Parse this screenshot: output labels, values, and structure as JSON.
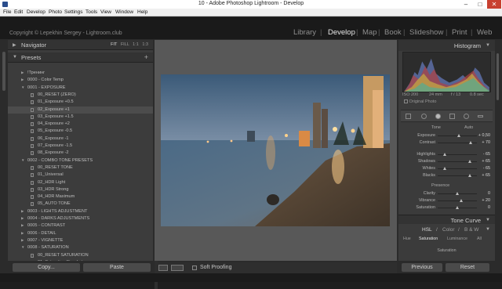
{
  "window": {
    "title": "10 - Adobe Photoshop Lightroom - Develop",
    "controls": [
      "–",
      "□",
      "✕"
    ]
  },
  "menu": [
    "File",
    "Edit",
    "Develop",
    "Photo",
    "Settings",
    "Tools",
    "View",
    "Window",
    "Help"
  ],
  "identity_plate": "Copyright © Lepekhin Sergey - Lightroom.club",
  "modules": {
    "items": [
      "Library",
      "Develop",
      "Map",
      "Book",
      "Slideshow",
      "Print",
      "Web"
    ],
    "active": "Develop",
    "separator": "|"
  },
  "navigator": {
    "label": "Navigator",
    "zoom_options": [
      "FIT",
      "FILL",
      "1:1",
      "1:3"
    ],
    "selected_zoom": "FIT"
  },
  "presets": {
    "label": "Presets",
    "add_symbol": "+",
    "items": [
      {
        "label": "!Тренинг",
        "level": 0,
        "expanded": false
      },
      {
        "label": "0000 - Color Temp",
        "level": 0,
        "expanded": false
      },
      {
        "label": "0001 - EXPOSURE",
        "level": 0,
        "expanded": true
      },
      {
        "label": "00_RESET (ZERO)",
        "level": 1
      },
      {
        "label": "01_Exposure +0.5",
        "level": 1
      },
      {
        "label": "02_Exposure +1",
        "level": 1,
        "highlighted": true
      },
      {
        "label": "03_Exposure +1.5",
        "level": 1
      },
      {
        "label": "04_Exposure +2",
        "level": 1
      },
      {
        "label": "05_Exposure -0.5",
        "level": 1
      },
      {
        "label": "06_Exposure -1",
        "level": 1
      },
      {
        "label": "07_Exposure -1.5",
        "level": 1
      },
      {
        "label": "08_Exposure -2",
        "level": 1
      },
      {
        "label": "0002 - COMBO TONE PRESETS",
        "level": 0,
        "expanded": true
      },
      {
        "label": "00_RESET TONE",
        "level": 1
      },
      {
        "label": "01_Universal",
        "level": 1
      },
      {
        "label": "02_HDR Light",
        "level": 1
      },
      {
        "label": "03_HDR Strong",
        "level": 1
      },
      {
        "label": "04_HDR Maximum",
        "level": 1
      },
      {
        "label": "05_AUTO TONE",
        "level": 1
      },
      {
        "label": "0003 - LIGHTS ADJUSTMENT",
        "level": 0,
        "expanded": false
      },
      {
        "label": "0004 - DARKS ADJUSTMENTS",
        "level": 0,
        "expanded": false
      },
      {
        "label": "0005 - CONTRAST",
        "level": 0,
        "expanded": false
      },
      {
        "label": "0006 - DETAIL",
        "level": 0,
        "expanded": false
      },
      {
        "label": "0007 - VIGNETTE",
        "level": 0,
        "expanded": false
      },
      {
        "label": "0008 - SATURATION",
        "level": 0,
        "expanded": true
      },
      {
        "label": "00_RESET SATURATION",
        "level": 1
      },
      {
        "label": "01_Saturation Standart",
        "level": 1
      }
    ]
  },
  "left_buttons": {
    "copy": "Copy...",
    "paste": "Paste"
  },
  "toolbar": {
    "soft_proofing": "Soft Proofing"
  },
  "histogram": {
    "label": "Histogram",
    "info": {
      "iso": "ISO 200",
      "focal": "24 mm",
      "aperture": "f / 13",
      "shutter": "0.8 sec"
    },
    "original_photo": "Original Photo"
  },
  "basic": {
    "tone_label": "Tone",
    "auto_label": "Auto",
    "presence_label": "Presence",
    "sliders": [
      {
        "name": "Exposure",
        "value": "+ 0,50",
        "pos": 0.55
      },
      {
        "name": "Contrast",
        "value": "+ 70",
        "pos": 0.85
      },
      {
        "name": "Highlights",
        "value": "- 65",
        "pos": 0.18
      },
      {
        "name": "Shadows",
        "value": "+ 65",
        "pos": 0.82
      },
      {
        "name": "Whites",
        "value": "- 65",
        "pos": 0.18
      },
      {
        "name": "Blacks",
        "value": "+ 65",
        "pos": 0.82
      },
      {
        "name": "Clarity",
        "value": "0",
        "pos": 0.5
      },
      {
        "name": "Vibrance",
        "value": "+ 20",
        "pos": 0.6
      },
      {
        "name": "Saturation",
        "value": "0",
        "pos": 0.5
      }
    ]
  },
  "tone_curve": {
    "label": "Tone Curve"
  },
  "hsl": {
    "tabs": [
      "HSL",
      "Color",
      "B & W"
    ],
    "tab_separator": "/",
    "subtabs": [
      "Hue",
      "Saturation",
      "Luminance",
      "All"
    ],
    "active_subtab": "Saturation",
    "section_label": "Saturation"
  },
  "right_buttons": {
    "previous": "Previous",
    "reset": "Reset"
  },
  "colors": {
    "panel": "#3c3c3c",
    "background": "#585858",
    "accent": "#e6e6e6"
  }
}
